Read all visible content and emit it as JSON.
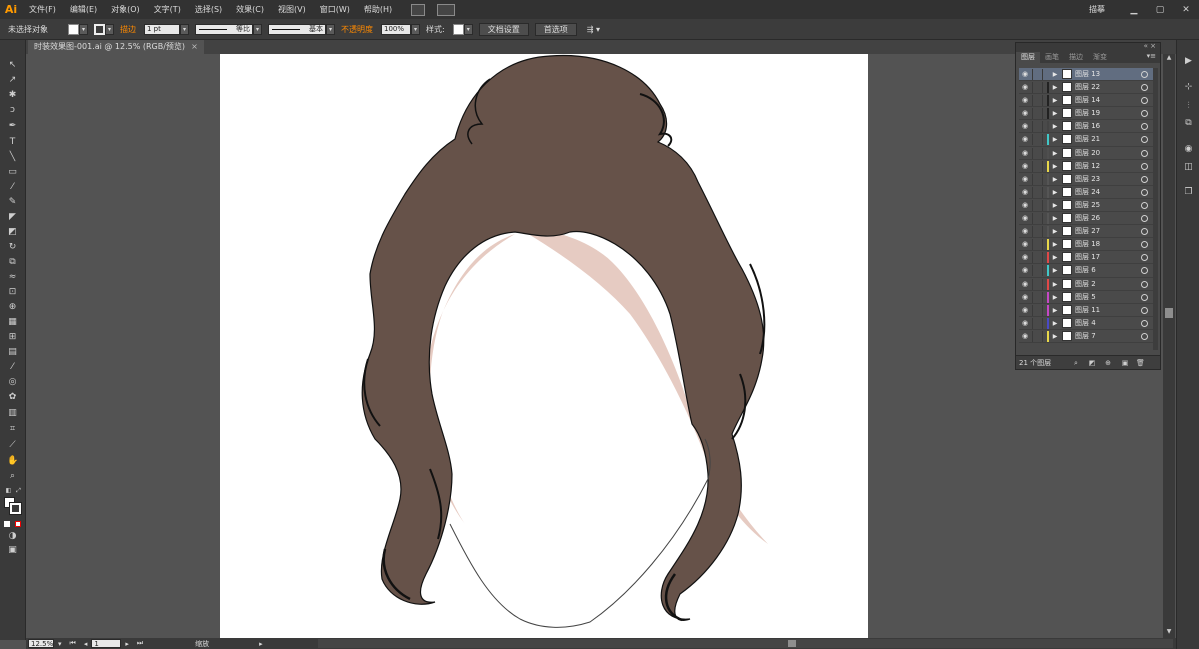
{
  "app": {
    "logo": "Ai",
    "menu": [
      "文件(F)",
      "编辑(E)",
      "对象(O)",
      "文字(T)",
      "选择(S)",
      "效果(C)",
      "视图(V)",
      "窗口(W)",
      "帮助(H)"
    ],
    "workspace": "描摹"
  },
  "control_bar": {
    "selection_status": "未选择对象",
    "stroke_label": "描边",
    "stroke_weight": "1 pt",
    "profile_label": "等比",
    "brush_label": "基本",
    "opacity_label": "不透明度",
    "opacity_value": "100%",
    "style_label": "样式:",
    "doc_setup_button": "文档设置",
    "preferences_button": "首选项"
  },
  "document": {
    "tab_title": "时装效果图-001.ai @ 12.5% (RGB/预览)",
    "close_glyph": "×",
    "hair_color": "#665249",
    "skin_shadow_color": "#e6cbc2",
    "outline_color": "#111111"
  },
  "status_bar": {
    "zoom": "12.5%",
    "artboard_index": "1",
    "status_text": "缩放"
  },
  "layers_panel": {
    "tabs": [
      "图层",
      "画笔",
      "描边",
      "渐变"
    ],
    "active_tab": "图层",
    "layer_count_text": "21 个图层",
    "selected_color": "#616d80",
    "layers": [
      {
        "name": "图层 13",
        "color": "#616d80",
        "selected": true
      },
      {
        "name": "图层 22",
        "color": "#222222"
      },
      {
        "name": "图层 14",
        "color": "#222222"
      },
      {
        "name": "图层 19",
        "color": "#222222"
      },
      {
        "name": "图层 16",
        "color": "#444444"
      },
      {
        "name": "图层 21",
        "color": "#41c7c7"
      },
      {
        "name": "图层 20",
        "color": "#4f4f4f"
      },
      {
        "name": "图层 12",
        "color": "#e8d84a"
      },
      {
        "name": "图层 23",
        "color": "#555555"
      },
      {
        "name": "图层 24",
        "color": "#555555"
      },
      {
        "name": "图层 25",
        "color": "#555555"
      },
      {
        "name": "图层 26",
        "color": "#555555"
      },
      {
        "name": "图层 27",
        "color": "#555555"
      },
      {
        "name": "图层 18",
        "color": "#e8d84a"
      },
      {
        "name": "图层 17",
        "color": "#e04848"
      },
      {
        "name": "图层 6",
        "color": "#41c7c7"
      },
      {
        "name": "图层 2",
        "color": "#e04848"
      },
      {
        "name": "图层 5",
        "color": "#c548c5"
      },
      {
        "name": "图层 11",
        "color": "#c548c5"
      },
      {
        "name": "图层 4",
        "color": "#4a4ac5"
      },
      {
        "name": "图层 7",
        "color": "#e8d84a"
      }
    ]
  }
}
